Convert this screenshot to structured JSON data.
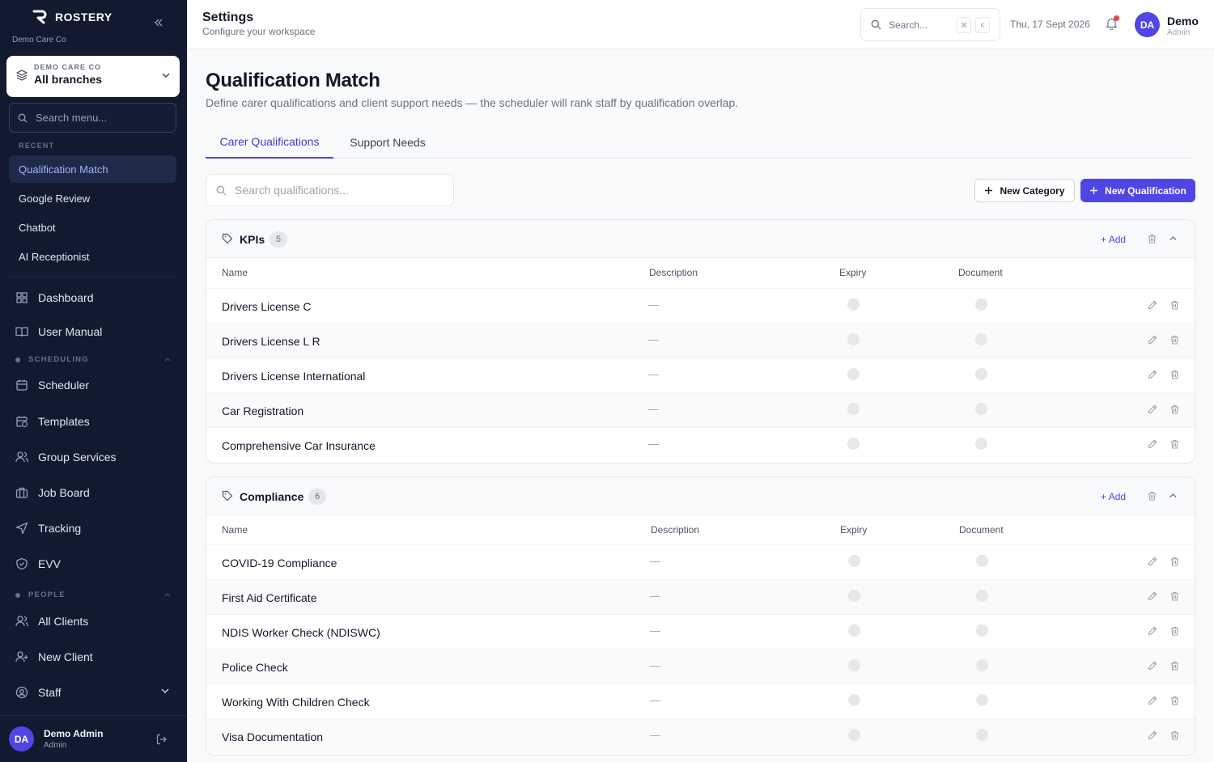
{
  "colors": {
    "accent": "#4f46e5",
    "sidebar_bg": "#111a2e",
    "notification": "#ef4444"
  },
  "sidebar": {
    "brand": "ROSTERY",
    "org": "Demo Care Co",
    "branch_label": "DEMO CARE CO",
    "branch_value": "All branches",
    "search_placeholder": "Search menu...",
    "recent_label": "RECENT",
    "recent": [
      {
        "label": "Qualification Match",
        "active": true
      },
      {
        "label": "Google Review"
      },
      {
        "label": "Chatbot"
      },
      {
        "label": "AI Receptionist"
      }
    ],
    "nav_top": [
      {
        "label": "Dashboard",
        "icon": "grid-icon"
      },
      {
        "label": "User Manual",
        "icon": "book-icon"
      }
    ],
    "scheduling_label": "SCHEDULING",
    "scheduling": [
      {
        "label": "Scheduler",
        "icon": "calendar-icon"
      },
      {
        "label": "Templates",
        "icon": "calendar-clock-icon"
      },
      {
        "label": "Group Services",
        "icon": "users-icon"
      },
      {
        "label": "Job Board",
        "icon": "briefcase-icon"
      },
      {
        "label": "Tracking",
        "icon": "navigation-icon"
      },
      {
        "label": "EVV",
        "icon": "shield-icon"
      }
    ],
    "people_label": "PEOPLE",
    "people": [
      {
        "label": "All Clients",
        "icon": "users-icon"
      },
      {
        "label": "New Client",
        "icon": "user-plus-icon"
      },
      {
        "label": "Staff",
        "icon": "user-circle-icon"
      }
    ],
    "user": {
      "initials": "DA",
      "name": "Demo Admin",
      "role": "Admin"
    }
  },
  "header": {
    "title": "Settings",
    "subtitle": "Configure your workspace",
    "search_placeholder": "Search...",
    "kbd1": "⌘",
    "kbd2": "K",
    "date": "Thu, 17 Sept 2026",
    "user": {
      "initials": "DA",
      "name": "Demo",
      "role": "Admin"
    }
  },
  "page": {
    "title": "Qualification Match",
    "description": "Define carer qualifications and client support needs — the scheduler will rank staff by qualification overlap.",
    "tabs": [
      {
        "label": "Carer Qualifications",
        "active": true
      },
      {
        "label": "Support Needs"
      }
    ],
    "search_placeholder": "Search qualifications...",
    "new_category": "New Category",
    "new_qualification": "New Qualification"
  },
  "columns": {
    "name": "Name",
    "description": "Description",
    "expiry": "Expiry",
    "document": "Document"
  },
  "add_label": "Add",
  "dash": "—",
  "categories": [
    {
      "name": "KPIs",
      "count": "5",
      "items": [
        "Drivers License C",
        "Drivers License L R",
        "Drivers License International",
        "Car Registration",
        "Comprehensive Car Insurance"
      ]
    },
    {
      "name": "Compliance",
      "count": "6",
      "items": [
        "COVID-19 Compliance",
        "First Aid Certificate",
        "NDIS Worker Check (NDISWC)",
        "Police Check",
        "Working With Children Check",
        "Visa Documentation"
      ]
    }
  ]
}
